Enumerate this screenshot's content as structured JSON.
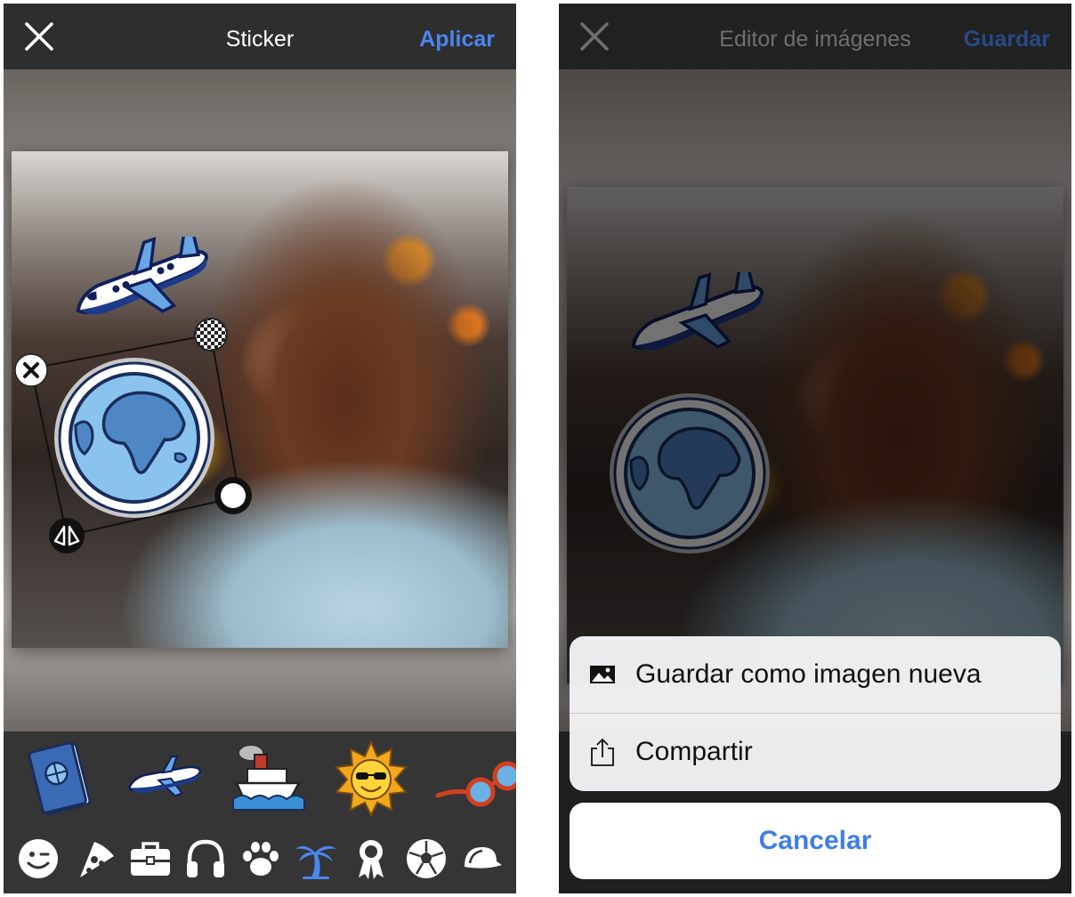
{
  "left_screen": {
    "title": "Sticker",
    "action_label": "Aplicar",
    "close_icon": "close-icon",
    "selected_sticker": "globe-sticker",
    "placed_stickers": [
      "airplane-sticker",
      "globe-sticker"
    ],
    "handles": [
      "delete-handle",
      "opacity-handle",
      "flip-handle",
      "resize-handle"
    ],
    "tray_stickers": [
      "passport-sticker",
      "airplane-sticker",
      "ship-sticker",
      "sun-sticker",
      "sunglasses-sticker"
    ],
    "categories": [
      "smiley-icon",
      "pizza-icon",
      "briefcase-icon",
      "headphones-icon",
      "paw-icon",
      "palm-tree-icon",
      "ribbon-icon",
      "soccer-ball-icon",
      "cap-icon"
    ],
    "selected_category": "palm-tree-icon"
  },
  "right_screen": {
    "title": "Editor de imágenes",
    "action_label": "Guardar",
    "close_icon": "close-icon",
    "action_sheet": {
      "items": [
        {
          "label": "Guardar como imagen nueva",
          "icon": "image-icon"
        },
        {
          "label": "Compartir",
          "icon": "share-icon"
        }
      ],
      "cancel_label": "Cancelar"
    }
  },
  "colors": {
    "accent": "#4a86ef",
    "navbar": "#2e2e2e",
    "tray": "#353535",
    "selected_category": "#4a86ef"
  }
}
